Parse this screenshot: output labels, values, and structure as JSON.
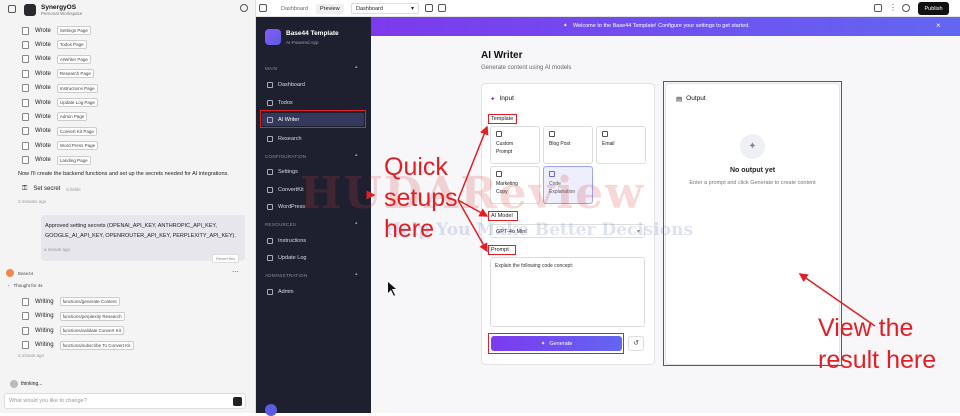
{
  "chat": {
    "workspace_name": "SynergyOS",
    "workspace_sub": "Personal Workspace",
    "wrote_items": [
      {
        "verb": "Wrote",
        "file": "Settings Page"
      },
      {
        "verb": "Wrote",
        "file": "Todos Page"
      },
      {
        "verb": "Wrote",
        "file": "AIWriter Page"
      },
      {
        "verb": "Wrote",
        "file": "Research Page"
      },
      {
        "verb": "Wrote",
        "file": "Instructions Page"
      },
      {
        "verb": "Wrote",
        "file": "Update Log Page"
      },
      {
        "verb": "Wrote",
        "file": "Admin Page"
      },
      {
        "verb": "Wrote",
        "file": "Convert Kit Page"
      },
      {
        "verb": "Wrote",
        "file": "Word Press Page"
      },
      {
        "verb": "Wrote",
        "file": "Landing Page"
      }
    ],
    "message": "Now I'll create the backend functions and set up the secrets needed for AI integrations.",
    "set_secret": "Set secret",
    "set_secret_count": "5 fields",
    "ts1": "2 minutes ago",
    "user_msg_l1": "Approved setting secrets (OPENAI_API_KEY, ANTHROPIC_API_KEY,",
    "user_msg_l2": "GOOGLE_AI_API_KEY, OPENROUTER_API_KEY, PERPLEXITY_API_KEY).",
    "ts2": "a minute ago",
    "revert": "Revert this",
    "agent_name": "Base44",
    "thought": "Thought for 4s",
    "writing_items": [
      {
        "verb": "Writing",
        "file": "functions/generate Content"
      },
      {
        "verb": "Writing",
        "file": "functions/perplexity Research"
      },
      {
        "verb": "Writing",
        "file": "functions/validate Convert Kit"
      },
      {
        "verb": "Writing",
        "file": "functions/subscribe To Convert Kit"
      }
    ],
    "ts3": "a minute ago",
    "thinking": "thinking...",
    "input_placeholder": "What would you like to change?"
  },
  "topbar": {
    "tab_dashboard": "Dashboard",
    "tab_preview": "Preview",
    "page_select": "Dashboard",
    "publish": "Publish"
  },
  "sidebar": {
    "app_name": "Base44 Template",
    "app_sub": "AI-Powered App",
    "sec_main": "MAIN",
    "sec_config": "CONFIGURATION",
    "sec_resources": "RESOURCES",
    "sec_admin": "ADMINISTRATION",
    "items": {
      "dashboard": "Dashboard",
      "todos": "Todos",
      "aiwriter": "AI Writer",
      "research": "Research",
      "settings": "Settings",
      "convertkit": "ConvertKit",
      "wordpress": "WordPress",
      "instructions": "Instructions",
      "updatelog": "Update Log",
      "admin": "Admin"
    }
  },
  "banner": {
    "text": "Welcome to the Base44 Template! Configure your settings to get started."
  },
  "main": {
    "title": "AI Writer",
    "subtitle": "Generate content using AI models",
    "input_title": "Input",
    "template_label": "Template",
    "templates": [
      {
        "l1": "Custom",
        "l2": "Prompt"
      },
      {
        "l1": "Blog Post",
        "l2": ""
      },
      {
        "l1": "Email",
        "l2": ""
      },
      {
        "l1": "Marketing",
        "l2": "Copy"
      },
      {
        "l1": "Code",
        "l2": "Explanation"
      }
    ],
    "model_label": "AI Model",
    "model_value": "GPT-4o Mini",
    "prompt_label": "Prompt",
    "prompt_value": "Explain the following code concept:",
    "generate": "Generate",
    "output_title": "Output",
    "no_output": "No output yet",
    "no_output_sub": "Enter a prompt and click Generate to create content"
  },
  "annotations": {
    "quick_l1": "Quick",
    "quick_l2": "setups",
    "quick_l3": "here",
    "view_l1": "View the",
    "view_l2": "result here"
  },
  "watermark": {
    "brand": "HUDAReview",
    "tagline": "Help You Make Better Decisions"
  },
  "colors": {
    "accent": "#7c3aed",
    "annotation": "#e31e24",
    "sidebar": "#1e2030"
  }
}
